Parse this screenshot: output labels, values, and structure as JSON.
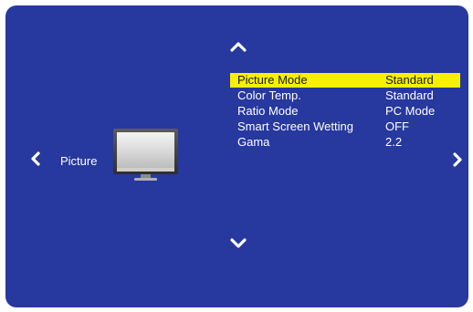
{
  "panel": {
    "bg_color": "#27389e",
    "section_label": "Picture",
    "section_icon": "tv-monitor-icon"
  },
  "nav": {
    "up": "chevron-up-icon",
    "down": "chevron-down-icon",
    "left": "chevron-left-icon",
    "right": "chevron-right-icon"
  },
  "menu": {
    "highlight_color": "#f7f000",
    "items": [
      {
        "label": "Picture Mode",
        "value": "Standard",
        "selected": true
      },
      {
        "label": "Color Temp.",
        "value": "Standard",
        "selected": false
      },
      {
        "label": "Ratio Mode",
        "value": "PC Mode",
        "selected": false
      },
      {
        "label": "Smart Screen Wetting",
        "value": "OFF",
        "selected": false
      },
      {
        "label": "Gama",
        "value": "2.2",
        "selected": false
      }
    ]
  }
}
